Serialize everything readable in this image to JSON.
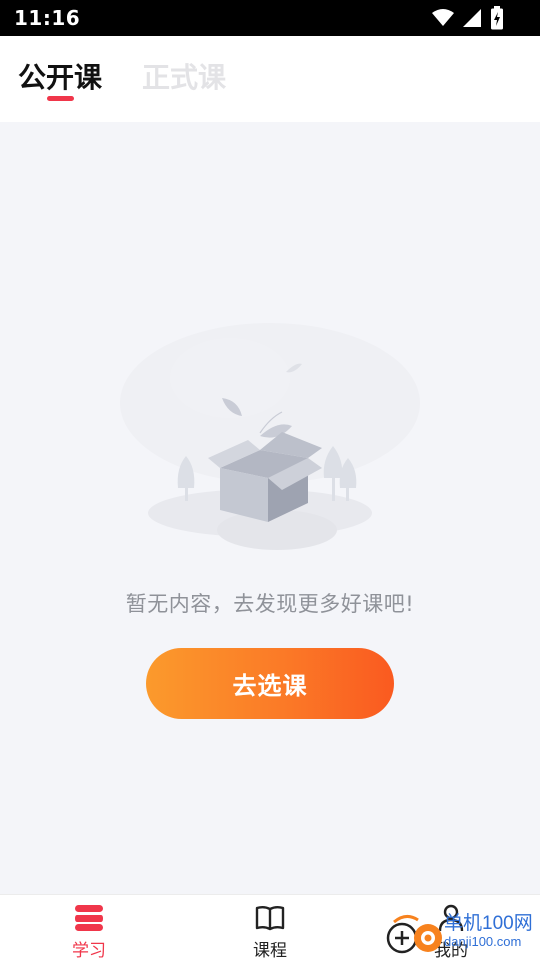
{
  "status_bar": {
    "time": "11:16",
    "icons": [
      "wifi-icon",
      "signal-icon",
      "battery-charging-icon"
    ]
  },
  "tabs": [
    {
      "label": "公开课",
      "active": true
    },
    {
      "label": "正式课",
      "active": false
    }
  ],
  "empty_state": {
    "illustration": "empty-box-illustration",
    "message": "暂无内容，去发现更多好课吧!",
    "button_label": "去选课"
  },
  "bottom_nav": [
    {
      "label": "学习",
      "icon": "stack-icon",
      "active": true
    },
    {
      "label": "课程",
      "icon": "open-book-icon",
      "active": false
    },
    {
      "label": "我的",
      "icon": "person-icon",
      "active": false
    }
  ],
  "watermark": {
    "name": "单机100网",
    "url": "danji100.com"
  },
  "colors": {
    "accent": "#f0364a",
    "button_start": "#fb9a2c",
    "button_end": "#fa5a20",
    "background": "#f4f5f9",
    "muted_text": "#8f9299"
  }
}
